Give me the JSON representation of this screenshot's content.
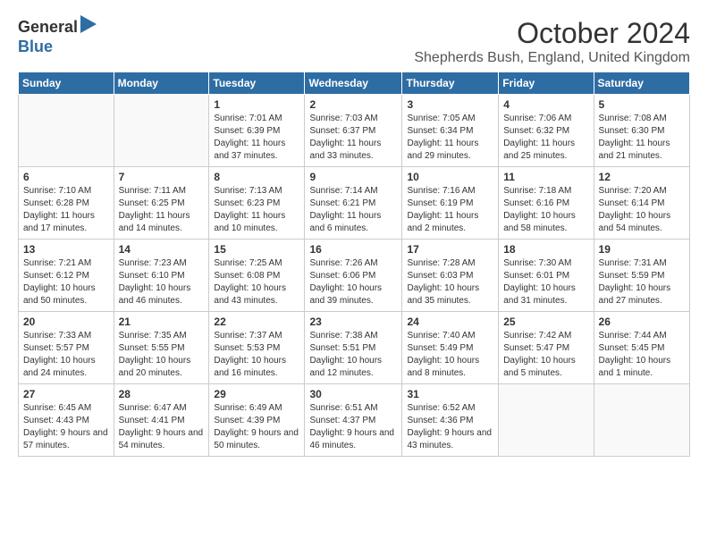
{
  "header": {
    "logo_general": "General",
    "logo_blue": "Blue",
    "title": "October 2024",
    "subtitle": "Shepherds Bush, England, United Kingdom"
  },
  "days_of_week": [
    "Sunday",
    "Monday",
    "Tuesday",
    "Wednesday",
    "Thursday",
    "Friday",
    "Saturday"
  ],
  "weeks": [
    [
      {
        "day": "",
        "info": ""
      },
      {
        "day": "",
        "info": ""
      },
      {
        "day": "1",
        "info": "Sunrise: 7:01 AM\nSunset: 6:39 PM\nDaylight: 11 hours and 37 minutes."
      },
      {
        "day": "2",
        "info": "Sunrise: 7:03 AM\nSunset: 6:37 PM\nDaylight: 11 hours and 33 minutes."
      },
      {
        "day": "3",
        "info": "Sunrise: 7:05 AM\nSunset: 6:34 PM\nDaylight: 11 hours and 29 minutes."
      },
      {
        "day": "4",
        "info": "Sunrise: 7:06 AM\nSunset: 6:32 PM\nDaylight: 11 hours and 25 minutes."
      },
      {
        "day": "5",
        "info": "Sunrise: 7:08 AM\nSunset: 6:30 PM\nDaylight: 11 hours and 21 minutes."
      }
    ],
    [
      {
        "day": "6",
        "info": "Sunrise: 7:10 AM\nSunset: 6:28 PM\nDaylight: 11 hours and 17 minutes."
      },
      {
        "day": "7",
        "info": "Sunrise: 7:11 AM\nSunset: 6:25 PM\nDaylight: 11 hours and 14 minutes."
      },
      {
        "day": "8",
        "info": "Sunrise: 7:13 AM\nSunset: 6:23 PM\nDaylight: 11 hours and 10 minutes."
      },
      {
        "day": "9",
        "info": "Sunrise: 7:14 AM\nSunset: 6:21 PM\nDaylight: 11 hours and 6 minutes."
      },
      {
        "day": "10",
        "info": "Sunrise: 7:16 AM\nSunset: 6:19 PM\nDaylight: 11 hours and 2 minutes."
      },
      {
        "day": "11",
        "info": "Sunrise: 7:18 AM\nSunset: 6:16 PM\nDaylight: 10 hours and 58 minutes."
      },
      {
        "day": "12",
        "info": "Sunrise: 7:20 AM\nSunset: 6:14 PM\nDaylight: 10 hours and 54 minutes."
      }
    ],
    [
      {
        "day": "13",
        "info": "Sunrise: 7:21 AM\nSunset: 6:12 PM\nDaylight: 10 hours and 50 minutes."
      },
      {
        "day": "14",
        "info": "Sunrise: 7:23 AM\nSunset: 6:10 PM\nDaylight: 10 hours and 46 minutes."
      },
      {
        "day": "15",
        "info": "Sunrise: 7:25 AM\nSunset: 6:08 PM\nDaylight: 10 hours and 43 minutes."
      },
      {
        "day": "16",
        "info": "Sunrise: 7:26 AM\nSunset: 6:06 PM\nDaylight: 10 hours and 39 minutes."
      },
      {
        "day": "17",
        "info": "Sunrise: 7:28 AM\nSunset: 6:03 PM\nDaylight: 10 hours and 35 minutes."
      },
      {
        "day": "18",
        "info": "Sunrise: 7:30 AM\nSunset: 6:01 PM\nDaylight: 10 hours and 31 minutes."
      },
      {
        "day": "19",
        "info": "Sunrise: 7:31 AM\nSunset: 5:59 PM\nDaylight: 10 hours and 27 minutes."
      }
    ],
    [
      {
        "day": "20",
        "info": "Sunrise: 7:33 AM\nSunset: 5:57 PM\nDaylight: 10 hours and 24 minutes."
      },
      {
        "day": "21",
        "info": "Sunrise: 7:35 AM\nSunset: 5:55 PM\nDaylight: 10 hours and 20 minutes."
      },
      {
        "day": "22",
        "info": "Sunrise: 7:37 AM\nSunset: 5:53 PM\nDaylight: 10 hours and 16 minutes."
      },
      {
        "day": "23",
        "info": "Sunrise: 7:38 AM\nSunset: 5:51 PM\nDaylight: 10 hours and 12 minutes."
      },
      {
        "day": "24",
        "info": "Sunrise: 7:40 AM\nSunset: 5:49 PM\nDaylight: 10 hours and 8 minutes."
      },
      {
        "day": "25",
        "info": "Sunrise: 7:42 AM\nSunset: 5:47 PM\nDaylight: 10 hours and 5 minutes."
      },
      {
        "day": "26",
        "info": "Sunrise: 7:44 AM\nSunset: 5:45 PM\nDaylight: 10 hours and 1 minute."
      }
    ],
    [
      {
        "day": "27",
        "info": "Sunrise: 6:45 AM\nSunset: 4:43 PM\nDaylight: 9 hours and 57 minutes."
      },
      {
        "day": "28",
        "info": "Sunrise: 6:47 AM\nSunset: 4:41 PM\nDaylight: 9 hours and 54 minutes."
      },
      {
        "day": "29",
        "info": "Sunrise: 6:49 AM\nSunset: 4:39 PM\nDaylight: 9 hours and 50 minutes."
      },
      {
        "day": "30",
        "info": "Sunrise: 6:51 AM\nSunset: 4:37 PM\nDaylight: 9 hours and 46 minutes."
      },
      {
        "day": "31",
        "info": "Sunrise: 6:52 AM\nSunset: 4:36 PM\nDaylight: 9 hours and 43 minutes."
      },
      {
        "day": "",
        "info": ""
      },
      {
        "day": "",
        "info": ""
      }
    ]
  ]
}
